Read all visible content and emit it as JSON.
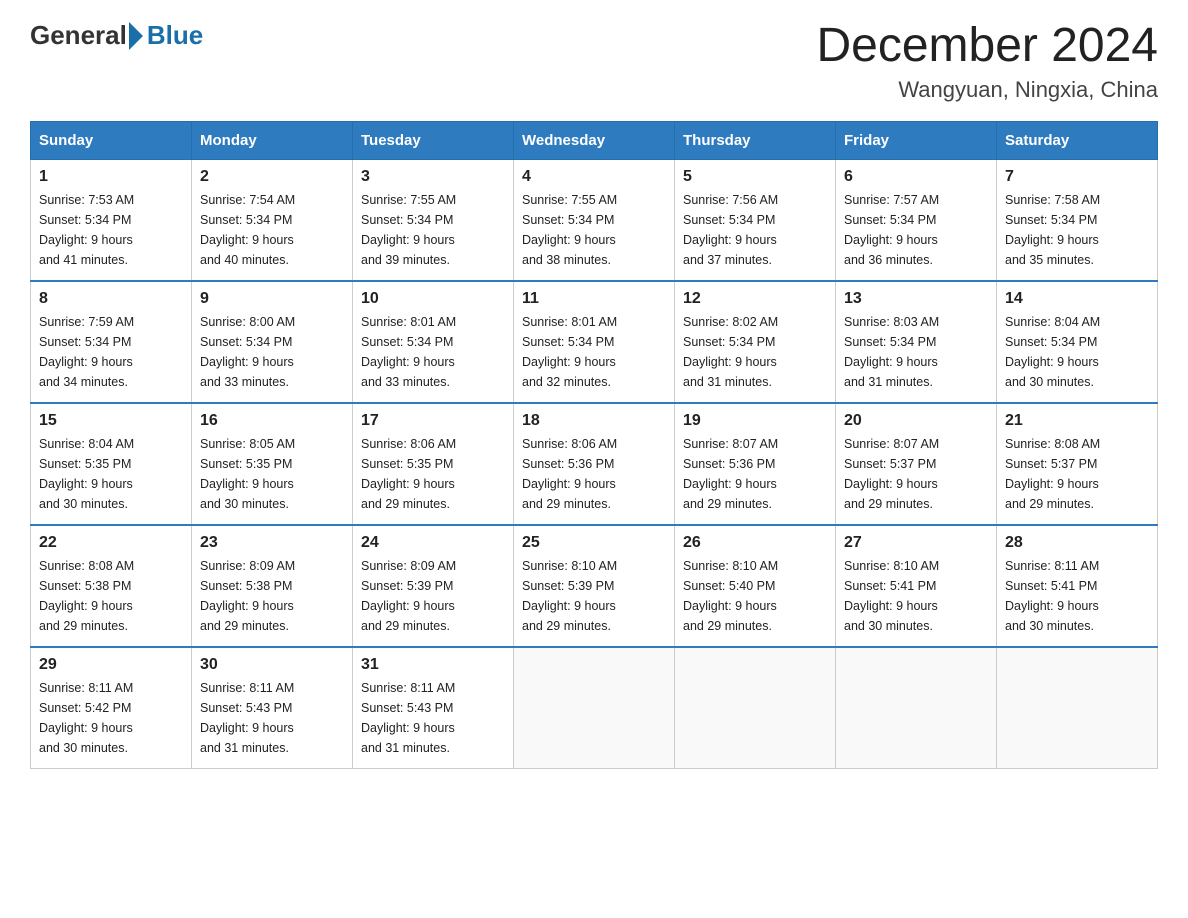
{
  "header": {
    "logo_general": "General",
    "logo_blue": "Blue",
    "title": "December 2024",
    "subtitle": "Wangyuan, Ningxia, China"
  },
  "days_of_week": [
    "Sunday",
    "Monday",
    "Tuesday",
    "Wednesday",
    "Thursday",
    "Friday",
    "Saturday"
  ],
  "weeks": [
    [
      {
        "day": "1",
        "sunrise": "7:53 AM",
        "sunset": "5:34 PM",
        "daylight": "9 hours and 41 minutes."
      },
      {
        "day": "2",
        "sunrise": "7:54 AM",
        "sunset": "5:34 PM",
        "daylight": "9 hours and 40 minutes."
      },
      {
        "day": "3",
        "sunrise": "7:55 AM",
        "sunset": "5:34 PM",
        "daylight": "9 hours and 39 minutes."
      },
      {
        "day": "4",
        "sunrise": "7:55 AM",
        "sunset": "5:34 PM",
        "daylight": "9 hours and 38 minutes."
      },
      {
        "day": "5",
        "sunrise": "7:56 AM",
        "sunset": "5:34 PM",
        "daylight": "9 hours and 37 minutes."
      },
      {
        "day": "6",
        "sunrise": "7:57 AM",
        "sunset": "5:34 PM",
        "daylight": "9 hours and 36 minutes."
      },
      {
        "day": "7",
        "sunrise": "7:58 AM",
        "sunset": "5:34 PM",
        "daylight": "9 hours and 35 minutes."
      }
    ],
    [
      {
        "day": "8",
        "sunrise": "7:59 AM",
        "sunset": "5:34 PM",
        "daylight": "9 hours and 34 minutes."
      },
      {
        "day": "9",
        "sunrise": "8:00 AM",
        "sunset": "5:34 PM",
        "daylight": "9 hours and 33 minutes."
      },
      {
        "day": "10",
        "sunrise": "8:01 AM",
        "sunset": "5:34 PM",
        "daylight": "9 hours and 33 minutes."
      },
      {
        "day": "11",
        "sunrise": "8:01 AM",
        "sunset": "5:34 PM",
        "daylight": "9 hours and 32 minutes."
      },
      {
        "day": "12",
        "sunrise": "8:02 AM",
        "sunset": "5:34 PM",
        "daylight": "9 hours and 31 minutes."
      },
      {
        "day": "13",
        "sunrise": "8:03 AM",
        "sunset": "5:34 PM",
        "daylight": "9 hours and 31 minutes."
      },
      {
        "day": "14",
        "sunrise": "8:04 AM",
        "sunset": "5:34 PM",
        "daylight": "9 hours and 30 minutes."
      }
    ],
    [
      {
        "day": "15",
        "sunrise": "8:04 AM",
        "sunset": "5:35 PM",
        "daylight": "9 hours and 30 minutes."
      },
      {
        "day": "16",
        "sunrise": "8:05 AM",
        "sunset": "5:35 PM",
        "daylight": "9 hours and 30 minutes."
      },
      {
        "day": "17",
        "sunrise": "8:06 AM",
        "sunset": "5:35 PM",
        "daylight": "9 hours and 29 minutes."
      },
      {
        "day": "18",
        "sunrise": "8:06 AM",
        "sunset": "5:36 PM",
        "daylight": "9 hours and 29 minutes."
      },
      {
        "day": "19",
        "sunrise": "8:07 AM",
        "sunset": "5:36 PM",
        "daylight": "9 hours and 29 minutes."
      },
      {
        "day": "20",
        "sunrise": "8:07 AM",
        "sunset": "5:37 PM",
        "daylight": "9 hours and 29 minutes."
      },
      {
        "day": "21",
        "sunrise": "8:08 AM",
        "sunset": "5:37 PM",
        "daylight": "9 hours and 29 minutes."
      }
    ],
    [
      {
        "day": "22",
        "sunrise": "8:08 AM",
        "sunset": "5:38 PM",
        "daylight": "9 hours and 29 minutes."
      },
      {
        "day": "23",
        "sunrise": "8:09 AM",
        "sunset": "5:38 PM",
        "daylight": "9 hours and 29 minutes."
      },
      {
        "day": "24",
        "sunrise": "8:09 AM",
        "sunset": "5:39 PM",
        "daylight": "9 hours and 29 minutes."
      },
      {
        "day": "25",
        "sunrise": "8:10 AM",
        "sunset": "5:39 PM",
        "daylight": "9 hours and 29 minutes."
      },
      {
        "day": "26",
        "sunrise": "8:10 AM",
        "sunset": "5:40 PM",
        "daylight": "9 hours and 29 minutes."
      },
      {
        "day": "27",
        "sunrise": "8:10 AM",
        "sunset": "5:41 PM",
        "daylight": "9 hours and 30 minutes."
      },
      {
        "day": "28",
        "sunrise": "8:11 AM",
        "sunset": "5:41 PM",
        "daylight": "9 hours and 30 minutes."
      }
    ],
    [
      {
        "day": "29",
        "sunrise": "8:11 AM",
        "sunset": "5:42 PM",
        "daylight": "9 hours and 30 minutes."
      },
      {
        "day": "30",
        "sunrise": "8:11 AM",
        "sunset": "5:43 PM",
        "daylight": "9 hours and 31 minutes."
      },
      {
        "day": "31",
        "sunrise": "8:11 AM",
        "sunset": "5:43 PM",
        "daylight": "9 hours and 31 minutes."
      },
      null,
      null,
      null,
      null
    ]
  ],
  "labels": {
    "sunrise": "Sunrise:",
    "sunset": "Sunset:",
    "daylight": "Daylight:"
  }
}
